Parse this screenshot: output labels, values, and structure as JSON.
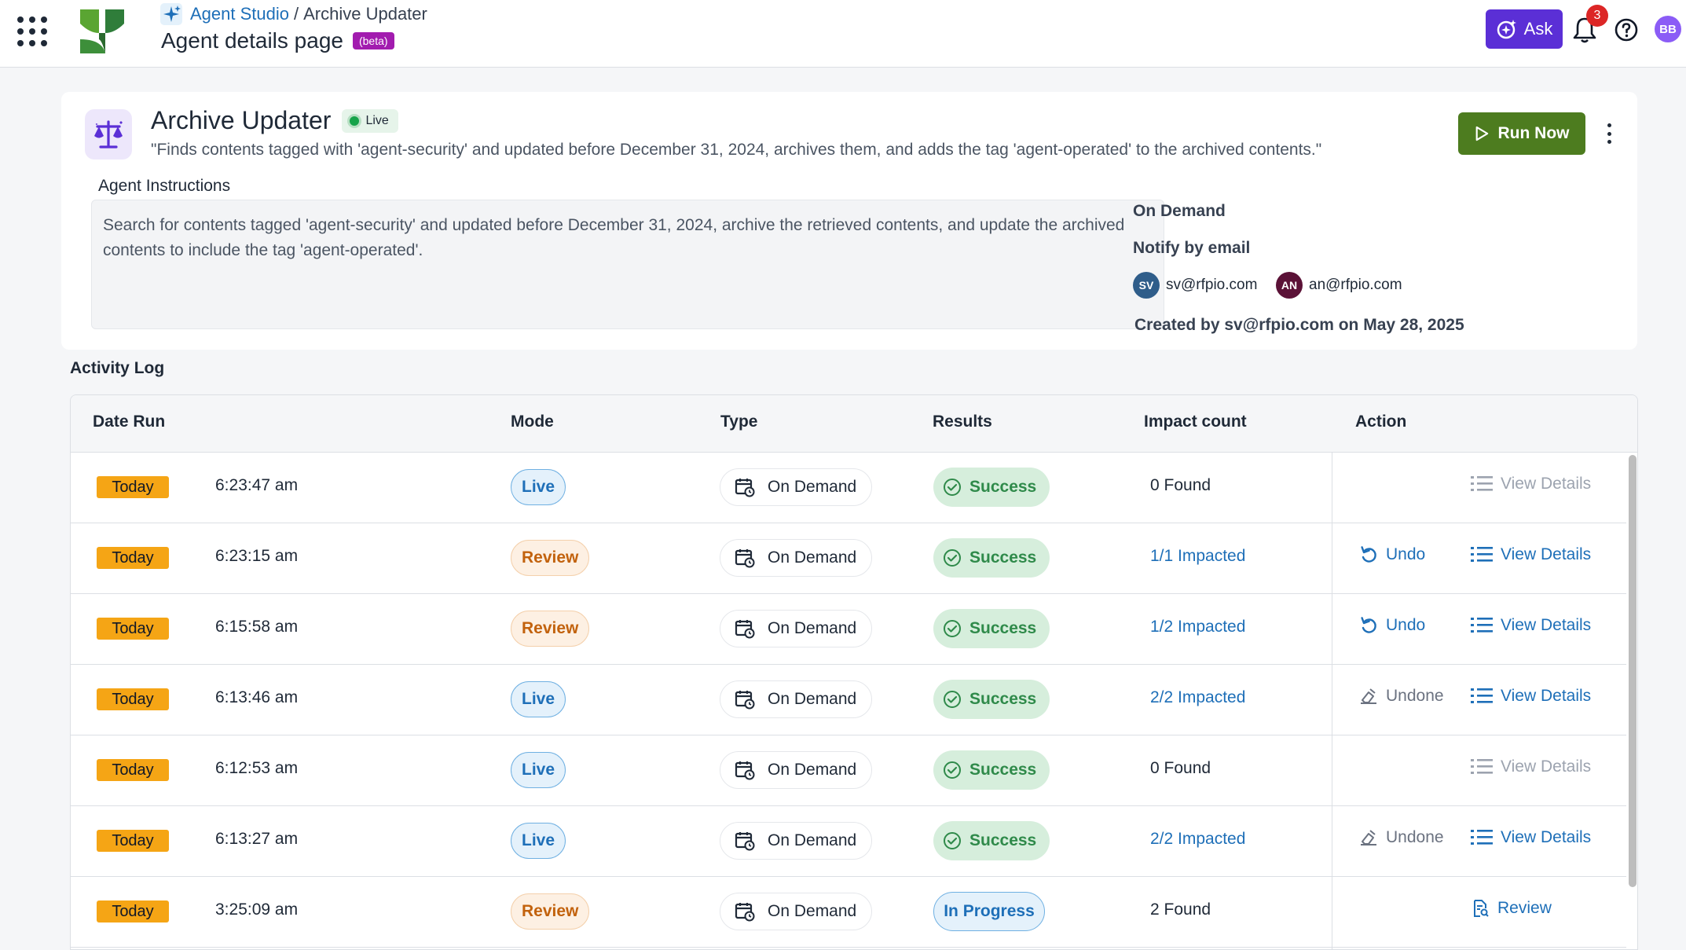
{
  "header": {
    "breadcrumb_root": "Agent Studio",
    "breadcrumb_sep": "/",
    "breadcrumb_current": "Archive Updater",
    "page_title": "Agent details page",
    "beta_label": "(beta)",
    "ask_label": "Ask",
    "notification_count": "3",
    "user_initials": "BB"
  },
  "agent": {
    "name": "Archive Updater",
    "status": "Live",
    "description": "\"Finds contents tagged with 'agent-security' and updated before December 31, 2024, archives them, and adds the tag 'agent-operated' to the archived contents.\"",
    "run_now_label": "Run Now",
    "instructions_label": "Agent Instructions",
    "instructions_text": "Search for contents tagged 'agent-security' and updated before December 31, 2024, archive the retrieved contents, and update the archived contents to include the tag 'agent-operated'.",
    "trigger": "On Demand",
    "notify_label": "Notify by email",
    "recipients": [
      {
        "initials": "SV",
        "email": "sv@rfpio.com",
        "color": "#2f5d8a"
      },
      {
        "initials": "AN",
        "email": "an@rfpio.com",
        "color": "#5b1237"
      }
    ],
    "created_by": "Created by sv@rfpio.com on May 28, 2025"
  },
  "activity_log": {
    "title": "Activity Log",
    "columns": [
      "Date Run",
      "Mode",
      "Type",
      "Results",
      "Impact count",
      "Action"
    ],
    "rows": [
      {
        "day": "Today",
        "time": "6:23:47 am",
        "mode": "Live",
        "type": "On Demand",
        "result": "Success",
        "impact": "0 Found",
        "impact_link": false,
        "undo": "",
        "undo_state": "none",
        "action": "View Details",
        "action_state": "muted"
      },
      {
        "day": "Today",
        "time": "6:23:15 am",
        "mode": "Review",
        "type": "On Demand",
        "result": "Success",
        "impact": "1/1 Impacted",
        "impact_link": true,
        "undo": "Undo",
        "undo_state": "active",
        "action": "View Details",
        "action_state": "active"
      },
      {
        "day": "Today",
        "time": "6:15:58 am",
        "mode": "Review",
        "type": "On Demand",
        "result": "Success",
        "impact": "1/2 Impacted",
        "impact_link": true,
        "undo": "Undo",
        "undo_state": "active",
        "action": "View Details",
        "action_state": "active"
      },
      {
        "day": "Today",
        "time": "6:13:46 am",
        "mode": "Live",
        "type": "On Demand",
        "result": "Success",
        "impact": "2/2 Impacted",
        "impact_link": true,
        "undo": "Undone",
        "undo_state": "done",
        "action": "View Details",
        "action_state": "active"
      },
      {
        "day": "Today",
        "time": "6:12:53 am",
        "mode": "Live",
        "type": "On Demand",
        "result": "Success",
        "impact": "0 Found",
        "impact_link": false,
        "undo": "",
        "undo_state": "none",
        "action": "View Details",
        "action_state": "muted"
      },
      {
        "day": "Today",
        "time": "6:13:27 am",
        "mode": "Live",
        "type": "On Demand",
        "result": "Success",
        "impact": "2/2 Impacted",
        "impact_link": true,
        "undo": "Undone",
        "undo_state": "done",
        "action": "View Details",
        "action_state": "active"
      },
      {
        "day": "Today",
        "time": "3:25:09 am",
        "mode": "Review",
        "type": "On Demand",
        "result": "In Progress",
        "impact": "2 Found",
        "impact_link": false,
        "undo": "",
        "undo_state": "none",
        "action": "Review",
        "action_state": "review"
      }
    ]
  },
  "colors": {
    "accent_blue": "#1e6fb8",
    "run_green": "#4d7c1f",
    "ask_purple": "#5b2fd6",
    "today_orange": "#f5a515",
    "success_green": "#2f8a4a"
  }
}
